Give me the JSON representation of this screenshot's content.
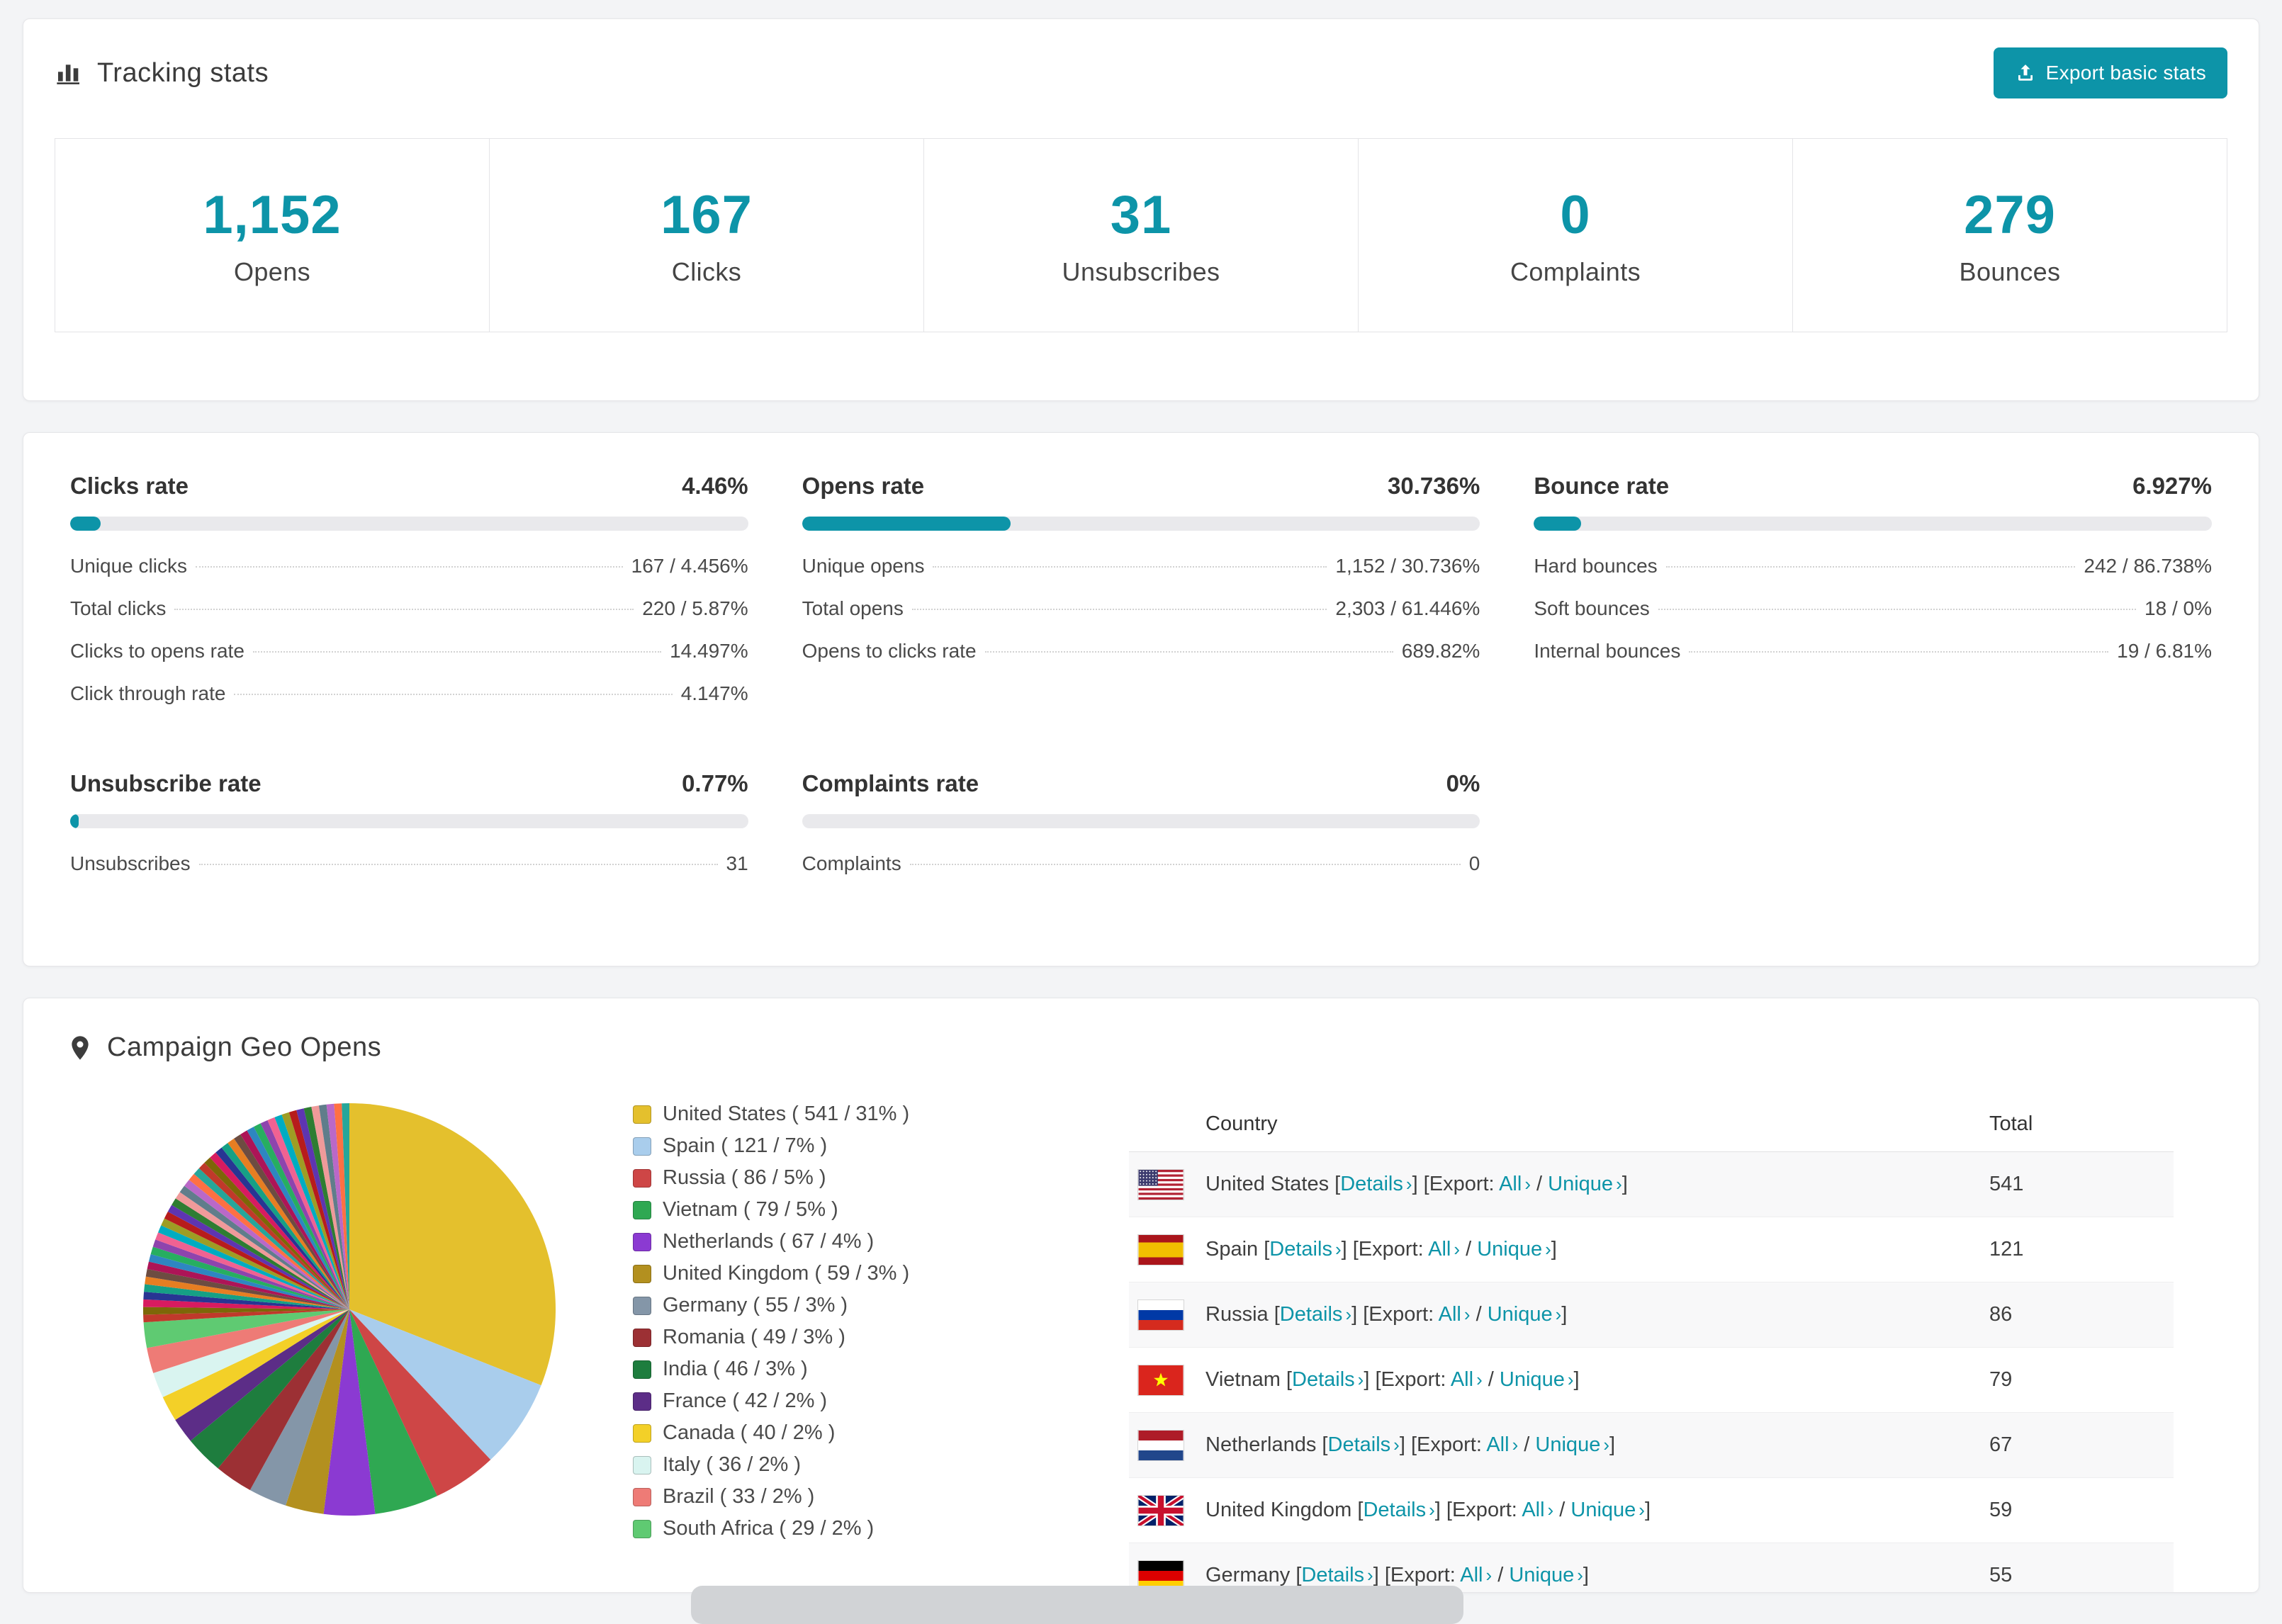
{
  "theme": {
    "accent": "#0d94a8",
    "link": "#0d94a8"
  },
  "tracking": {
    "title": "Tracking stats",
    "export_button": "Export basic stats",
    "stats": [
      {
        "value": "1,152",
        "label": "Opens"
      },
      {
        "value": "167",
        "label": "Clicks"
      },
      {
        "value": "31",
        "label": "Unsubscribes"
      },
      {
        "value": "0",
        "label": "Complaints"
      },
      {
        "value": "279",
        "label": "Bounces"
      }
    ]
  },
  "rates": [
    {
      "title": "Clicks rate",
      "value": "4.46%",
      "percent": 4.46,
      "rows": [
        [
          "Unique clicks",
          "167 / 4.456%"
        ],
        [
          "Total clicks",
          "220 / 5.87%"
        ],
        [
          "Clicks to opens rate",
          "14.497%"
        ],
        [
          "Click through rate",
          "4.147%"
        ]
      ]
    },
    {
      "title": "Opens rate",
      "value": "30.736%",
      "percent": 30.736,
      "rows": [
        [
          "Unique opens",
          "1,152 / 30.736%"
        ],
        [
          "Total opens",
          "2,303 / 61.446%"
        ],
        [
          "Opens to clicks rate",
          "689.82%"
        ]
      ]
    },
    {
      "title": "Bounce rate",
      "value": "6.927%",
      "percent": 6.927,
      "rows": [
        [
          "Hard bounces",
          "242 / 86.738%"
        ],
        [
          "Soft bounces",
          "18 / 0%"
        ],
        [
          "Internal bounces",
          "19 / 6.81%"
        ]
      ]
    },
    {
      "title": "Unsubscribe rate",
      "value": "0.77%",
      "percent": 0.77,
      "rows": [
        [
          "Unsubscribes",
          "31"
        ]
      ]
    },
    {
      "title": "Complaints rate",
      "value": "0%",
      "percent": 0,
      "rows": [
        [
          "Complaints",
          "0"
        ]
      ]
    }
  ],
  "geo": {
    "title": "Campaign Geo Opens",
    "table": {
      "headers": [
        "Country",
        "Total"
      ],
      "details_label": "Details",
      "export_prefix": "Export:",
      "all_label": "All",
      "unique_label": "Unique",
      "rows": [
        {
          "country": "United States",
          "flag": "us",
          "total": "541"
        },
        {
          "country": "Spain",
          "flag": "es",
          "total": "121"
        },
        {
          "country": "Russia",
          "flag": "ru",
          "total": "86"
        },
        {
          "country": "Vietnam",
          "flag": "vn",
          "total": "79"
        },
        {
          "country": "Netherlands",
          "flag": "nl",
          "total": "67"
        },
        {
          "country": "United Kingdom",
          "flag": "gb",
          "total": "59"
        },
        {
          "country": "Germany",
          "flag": "de",
          "total": "55"
        }
      ]
    }
  },
  "chart_data": {
    "type": "pie",
    "title": "Campaign Geo Opens",
    "legend_position": "right",
    "slices": [
      {
        "label": "United States",
        "count": 541,
        "pct": 31,
        "color": "#e4c02d"
      },
      {
        "label": "Spain",
        "count": 121,
        "pct": 7,
        "color": "#a9cdec"
      },
      {
        "label": "Russia",
        "count": 86,
        "pct": 5,
        "color": "#ce4646"
      },
      {
        "label": "Vietnam",
        "count": 79,
        "pct": 5,
        "color": "#2fa852"
      },
      {
        "label": "Netherlands",
        "count": 67,
        "pct": 4,
        "color": "#8b3ad2"
      },
      {
        "label": "United Kingdom",
        "count": 59,
        "pct": 3,
        "color": "#b3901f"
      },
      {
        "label": "Germany",
        "count": 55,
        "pct": 3,
        "color": "#8496a8"
      },
      {
        "label": "Romania",
        "count": 49,
        "pct": 3,
        "color": "#9c3034"
      },
      {
        "label": "India",
        "count": 46,
        "pct": 3,
        "color": "#1e7d3e"
      },
      {
        "label": "France",
        "count": 42,
        "pct": 2,
        "color": "#5c2d87"
      },
      {
        "label": "Canada",
        "count": 40,
        "pct": 2,
        "color": "#f3d028"
      },
      {
        "label": "Italy",
        "count": 36,
        "pct": 2,
        "color": "#d9f4f0"
      },
      {
        "label": "Brazil",
        "count": 33,
        "pct": 2,
        "color": "#ee7b76"
      },
      {
        "label": "South Africa",
        "count": 29,
        "pct": 2,
        "color": "#5fca72"
      }
    ],
    "others": {
      "total_pct": 26,
      "slice_count": 44,
      "palette": [
        "#c0392b",
        "#7d6608",
        "#d81b60",
        "#283593",
        "#16a085",
        "#e67e22",
        "#6d4c41",
        "#ad1457",
        "#2e86c1",
        "#27ae60",
        "#8e44ad",
        "#f06292",
        "#00acc1",
        "#9e9d24",
        "#b71c1c",
        "#5e35b1",
        "#2e7d32",
        "#ef9a9a",
        "#607d8b",
        "#ba68c8",
        "#ff7043",
        "#26a69a"
      ]
    }
  }
}
